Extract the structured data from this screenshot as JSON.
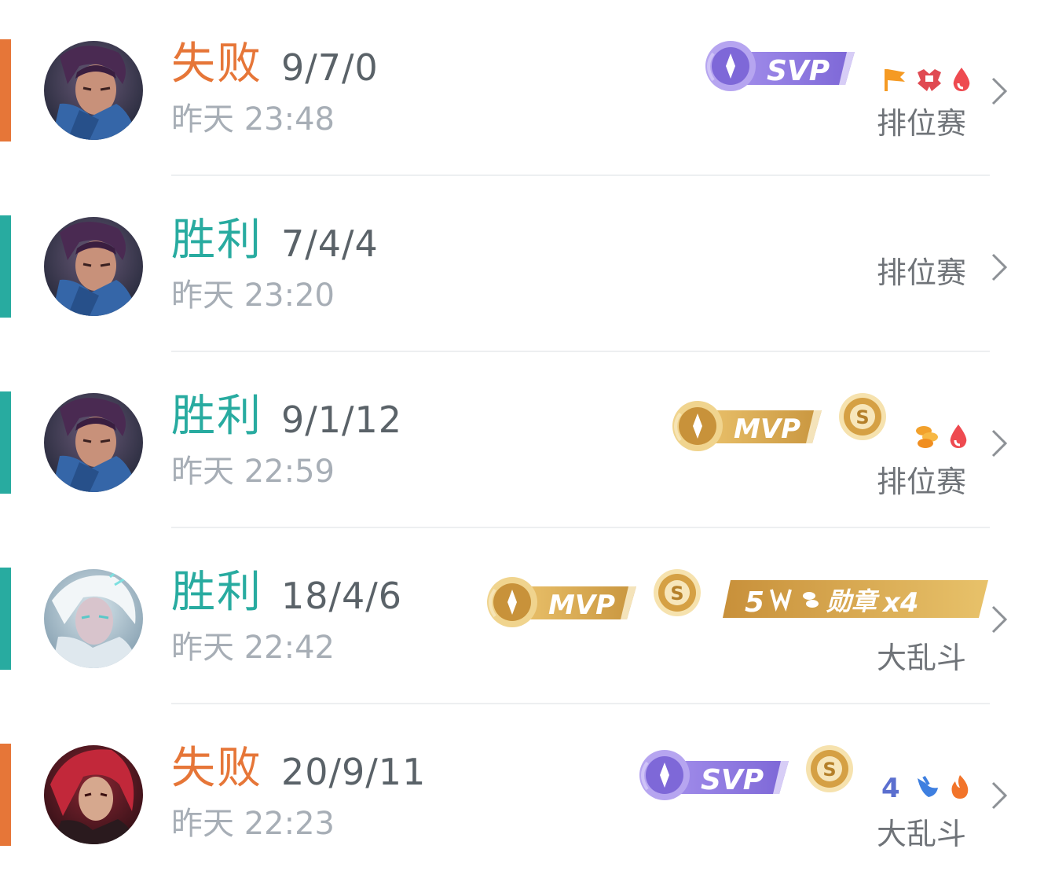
{
  "colors": {
    "loss": "#E67638",
    "win": "#28ABA0",
    "kda": "#5a6268",
    "time": "#A7AEB6",
    "mode": "#6f7378",
    "svp_purple": "#8B74E0",
    "mvp_gold": "#D8A84C"
  },
  "matches": [
    {
      "result": "失败",
      "outcome": "loss",
      "kda": "9/7/0",
      "time": "昨天 23:48",
      "mode": "排位赛",
      "hero_icon": "hero-portrait-purple-hair",
      "badges": [
        "SVP"
      ],
      "small_icons": [
        "flag-icon",
        "tower-icon",
        "blood-drop-icon"
      ]
    },
    {
      "result": "胜利",
      "outcome": "win",
      "kda": "7/4/4",
      "time": "昨天 23:20",
      "mode": "排位赛",
      "hero_icon": "hero-portrait-purple-hair",
      "badges": [],
      "small_icons": []
    },
    {
      "result": "胜利",
      "outcome": "win",
      "kda": "9/1/12",
      "time": "昨天 22:59",
      "mode": "排位赛",
      "hero_icon": "hero-portrait-purple-hair",
      "badges": [
        "MVP",
        "S"
      ],
      "small_icons": [
        "coins-icon",
        "blood-drop-icon"
      ]
    },
    {
      "result": "胜利",
      "outcome": "win",
      "kda": "18/4/6",
      "time": "昨天 22:42",
      "mode": "大乱斗",
      "hero_icon": "hero-portrait-white-hair",
      "badges": [
        "MVP",
        "S",
        "勋章x4"
      ],
      "medal_label": "勋章",
      "medal_count": "x4",
      "medal_prefix": "5",
      "small_icons": []
    },
    {
      "result": "失败",
      "outcome": "loss",
      "kda": "20/9/11",
      "time": "昨天 22:23",
      "mode": "大乱斗",
      "hero_icon": "hero-portrait-red-hair",
      "badges": [
        "SVP",
        "S"
      ],
      "small_icons": [
        "four-kill-icon",
        "water-icon",
        "fire-icon"
      ],
      "four_kill_label": "4"
    }
  ],
  "badge_labels": {
    "svp": "SVP",
    "mvp": "MVP",
    "s": "S"
  }
}
